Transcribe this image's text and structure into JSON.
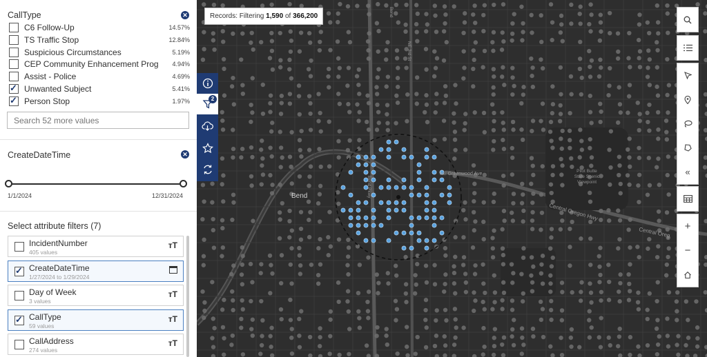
{
  "calltype_section": {
    "title": "CallType",
    "items": [
      {
        "label": "C6 Follow-Up",
        "pct": "14.57%",
        "checked": false
      },
      {
        "label": "TS Traffic Stop",
        "pct": "12.84%",
        "checked": false
      },
      {
        "label": "Suspicious Circumstances",
        "pct": "5.19%",
        "checked": false
      },
      {
        "label": "CEP Community Enhancement Prog",
        "pct": "4.94%",
        "checked": false
      },
      {
        "label": "Assist - Police",
        "pct": "4.69%",
        "checked": false
      },
      {
        "label": "Unwanted Subject",
        "pct": "5.41%",
        "checked": true
      },
      {
        "label": "Person Stop",
        "pct": "1.97%",
        "checked": true
      }
    ],
    "search_placeholder": "Search 52 more values"
  },
  "date_section": {
    "title": "CreateDateTime",
    "min_label": "1/1/2024",
    "max_label": "12/31/2024"
  },
  "attr_section": {
    "title": "Select attribute filters (7)",
    "items": [
      {
        "name": "IncidentNumber",
        "sub": "405 values",
        "type": "text",
        "checked": false
      },
      {
        "name": "CreateDateTime",
        "sub": "1/27/2024 to 1/29/2024",
        "type": "date",
        "checked": true
      },
      {
        "name": "Day of Week",
        "sub": "3 values",
        "type": "text",
        "checked": false
      },
      {
        "name": "CallType",
        "sub": "59 values",
        "type": "text",
        "checked": true
      },
      {
        "name": "CallAddress",
        "sub": "274 values",
        "type": "text",
        "checked": false
      }
    ]
  },
  "records": {
    "prefix": "Records: Filtering",
    "filtered": "1,590",
    "of": "of",
    "total": "366,200"
  },
  "map_labels": {
    "city": "Bend",
    "road1": "Central Oregon Hwy",
    "road2": "Central Oreg",
    "street1": "NE Greenwood Ave",
    "street2": "Bend Pkwy",
    "street3": "Pilot Butte State Scenic Viewpoint",
    "street4": "NE 3rd St",
    "street5": "Bend"
  },
  "tool_strip": {
    "filter_badge": "2",
    "icons": [
      "info-icon",
      "filter-icon",
      "download-icon",
      "star-icon",
      "refresh-icon"
    ]
  },
  "map_controls": {
    "icons": [
      "search-icon",
      "list-icon",
      "pointer-icon",
      "pin-icon",
      "lasso-icon",
      "polygon-icon",
      "collapse-icon",
      "table-icon",
      "zoom-in-icon",
      "zoom-out-icon",
      "home-icon"
    ]
  },
  "colors": {
    "accent": "#1f3b73",
    "map_bg": "#2e2e2e",
    "highlight_point": "#5aa3e0",
    "dim_point": "#6e6e6e"
  }
}
